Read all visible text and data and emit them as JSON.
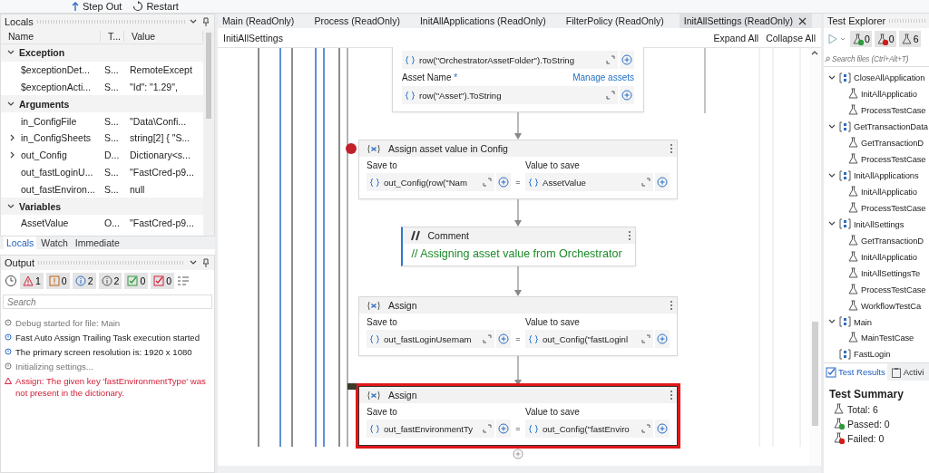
{
  "toolbar": {
    "buttons": [
      {
        "kind": "step-out",
        "label": "Step Out"
      },
      {
        "kind": "restart",
        "label": "Restart"
      }
    ]
  },
  "locals": {
    "title": "Locals",
    "columns": [
      "Name",
      "T...",
      "Value"
    ],
    "groups": [
      {
        "name": "Exception",
        "expanded": true,
        "rows": [
          {
            "name": "$exceptionDet...",
            "type": "S...",
            "value": "RemoteExcept",
            "expandable": false
          },
          {
            "name": "$exceptionActi...",
            "type": "S...",
            "value": "\"Id\": \"1.29\",",
            "expandable": false
          }
        ]
      },
      {
        "name": "Arguments",
        "expanded": true,
        "rows": [
          {
            "name": "in_ConfigFile",
            "type": "S...",
            "value": "\"Data\\Confi...",
            "expandable": false
          },
          {
            "name": "in_ConfigSheets",
            "type": "S...",
            "value": "string[2] { \"S...",
            "expandable": true
          },
          {
            "name": "out_Config",
            "type": "D...",
            "value": "Dictionary<s...",
            "expandable": true
          },
          {
            "name": "out_fastLoginU...",
            "type": "S...",
            "value": "\"FastCred-p9...",
            "expandable": false
          },
          {
            "name": "out_fastEnviron...",
            "type": "S...",
            "value": "null",
            "expandable": false
          }
        ]
      },
      {
        "name": "Variables",
        "expanded": true,
        "rows": [
          {
            "name": "AssetValue",
            "type": "O...",
            "value": "\"FastCred-p9...",
            "expandable": false
          }
        ]
      }
    ]
  },
  "debug_tabs": [
    {
      "label": "Locals",
      "selected": true
    },
    {
      "label": "Watch",
      "selected": false
    },
    {
      "label": "Immediate",
      "selected": false
    }
  ],
  "output": {
    "title": "Output",
    "filters": [
      {
        "kind": "error",
        "count": "1"
      },
      {
        "kind": "warning",
        "count": "0"
      },
      {
        "kind": "info",
        "count": "2"
      },
      {
        "kind": "trace",
        "count": "2"
      },
      {
        "kind": "passed",
        "count": "0"
      },
      {
        "kind": "failed",
        "count": "0"
      }
    ],
    "search": {
      "placeholder": "Search"
    },
    "messages": [
      {
        "kind": "debug",
        "text": "Debug started for file: Main"
      },
      {
        "kind": "info",
        "text": "Fast Auto Assign Trailing Task execution started"
      },
      {
        "kind": "info",
        "text": "The primary screen resolution is: 1920 x 1080"
      },
      {
        "kind": "debug",
        "text": "Initializing settings..."
      },
      {
        "kind": "error",
        "text": "Assign: The given key 'fastEnvironmentType' was not present in the dictionary."
      }
    ]
  },
  "editor": {
    "tabs": [
      {
        "label": "Main (ReadOnly)",
        "selected": false
      },
      {
        "label": "Process (ReadOnly)",
        "selected": false
      },
      {
        "label": "InitAllApplications (ReadOnly)",
        "selected": false
      },
      {
        "label": "FilterPolicy (ReadOnly)",
        "selected": false
      },
      {
        "label": "InitAllSettings (ReadOnly)",
        "selected": true
      }
    ],
    "breadcrumb": "InitiAllSettings",
    "expand_all": "Expand All",
    "collapse_all": "Collapse All",
    "activities": [
      {
        "kind": "asset-fields",
        "fields": [
          {
            "value": "row(\"OrchestratorAssetFolder\").ToString"
          },
          {
            "label": "Asset Name",
            "required_marker": "*",
            "link": "Manage assets",
            "value": "row(\"Asset\").ToString"
          }
        ]
      },
      {
        "kind": "assign",
        "title": "Assign asset value in Config",
        "breakpoint": true,
        "selected": false,
        "save_label": "Save to",
        "save_to": "out_Config(row(\"Nam",
        "operator": "=",
        "value_label": "Value to save",
        "value": "AssetValue"
      },
      {
        "kind": "comment",
        "title": "Comment",
        "text": "// Assigning asset value from Orchestrator"
      },
      {
        "kind": "assign",
        "title": "Assign",
        "breakpoint": false,
        "selected": false,
        "save_label": "Save to",
        "save_to": "out_fastLoginUsernam",
        "operator": "=",
        "value_label": "Value to save",
        "value": "out_Config(\"fastLoginl"
      },
      {
        "kind": "assign",
        "title": "Assign",
        "breakpoint": false,
        "selected": true,
        "save_label": "Save to",
        "save_to": "out_fastEnvironmentTy",
        "operator": "=",
        "value_label": "Value to save",
        "value": "out_Config(\"fastEnviro"
      }
    ]
  },
  "test_explorer": {
    "title": "Test Explorer",
    "counts": [
      {
        "kind": "passed",
        "count": "0"
      },
      {
        "kind": "failed",
        "count": "0"
      },
      {
        "kind": "total",
        "count": "6"
      }
    ],
    "search": {
      "placeholder": "Search files (Ctrl+Alt+T)"
    },
    "tree": [
      {
        "label": "CloseAllApplication",
        "expanded": true,
        "children": [
          {
            "label": "InitAllApplicatio"
          },
          {
            "label": "ProcessTestCase"
          }
        ]
      },
      {
        "label": "GetTransactionData",
        "expanded": true,
        "children": [
          {
            "label": "GetTransactionD"
          },
          {
            "label": "ProcessTestCase"
          }
        ]
      },
      {
        "label": "InitAllApplications",
        "expanded": true,
        "children": [
          {
            "label": "InitAllApplicatio"
          },
          {
            "label": "ProcessTestCase"
          }
        ]
      },
      {
        "label": "InitAllSettings",
        "expanded": true,
        "children": [
          {
            "label": "GetTransactionD"
          },
          {
            "label": "InitAllApplicatio"
          },
          {
            "label": "InitAllSettingsTe"
          },
          {
            "label": "ProcessTestCase"
          },
          {
            "label": "WorkflowTestCa"
          }
        ]
      },
      {
        "label": "Main",
        "expanded": true,
        "children": [
          {
            "label": "MainTestCase"
          }
        ]
      },
      {
        "label": "FastLogin"
      }
    ],
    "tabs": [
      {
        "label": "Test Results",
        "selected": true
      },
      {
        "label": "Activi",
        "selected": false
      }
    ],
    "summary": {
      "title": "Test Summary",
      "items": [
        {
          "kind": "total",
          "text": "Total: 6"
        },
        {
          "kind": "passed",
          "text": "Passed: 0"
        },
        {
          "kind": "failed",
          "text": "Failed: 0"
        }
      ]
    }
  }
}
